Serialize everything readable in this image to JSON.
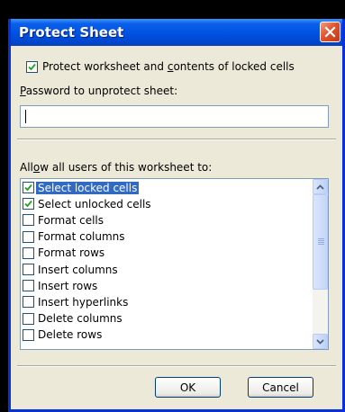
{
  "window": {
    "title": "Protect Sheet"
  },
  "protect_option": {
    "label_pre": "Protect worksheet and ",
    "label_accel": "c",
    "label_post": "ontents of locked cells",
    "checked": true
  },
  "password": {
    "label_accel": "P",
    "label_rest": "assword to unprotect sheet:",
    "value": ""
  },
  "allow": {
    "label_pre": "All",
    "label_accel": "o",
    "label_post": "w all users of this worksheet to:"
  },
  "permissions": [
    {
      "label": "Select locked cells",
      "checked": true,
      "selected": true
    },
    {
      "label": "Select unlocked cells",
      "checked": true,
      "selected": false
    },
    {
      "label": "Format cells",
      "checked": false,
      "selected": false
    },
    {
      "label": "Format columns",
      "checked": false,
      "selected": false
    },
    {
      "label": "Format rows",
      "checked": false,
      "selected": false
    },
    {
      "label": "Insert columns",
      "checked": false,
      "selected": false
    },
    {
      "label": "Insert rows",
      "checked": false,
      "selected": false
    },
    {
      "label": "Insert hyperlinks",
      "checked": false,
      "selected": false
    },
    {
      "label": "Delete columns",
      "checked": false,
      "selected": false
    },
    {
      "label": "Delete rows",
      "checked": false,
      "selected": false
    }
  ],
  "buttons": {
    "ok": "OK",
    "cancel": "Cancel"
  },
  "icons": {
    "close": "close-icon",
    "check": "checkmark-icon",
    "up": "scroll-up-arrow-icon",
    "down": "scroll-down-arrow-icon"
  },
  "colors": {
    "titlebar": "#0054e3",
    "selection": "#316ac5",
    "checkmark": "#21a121",
    "close_button": "#e2522c"
  }
}
